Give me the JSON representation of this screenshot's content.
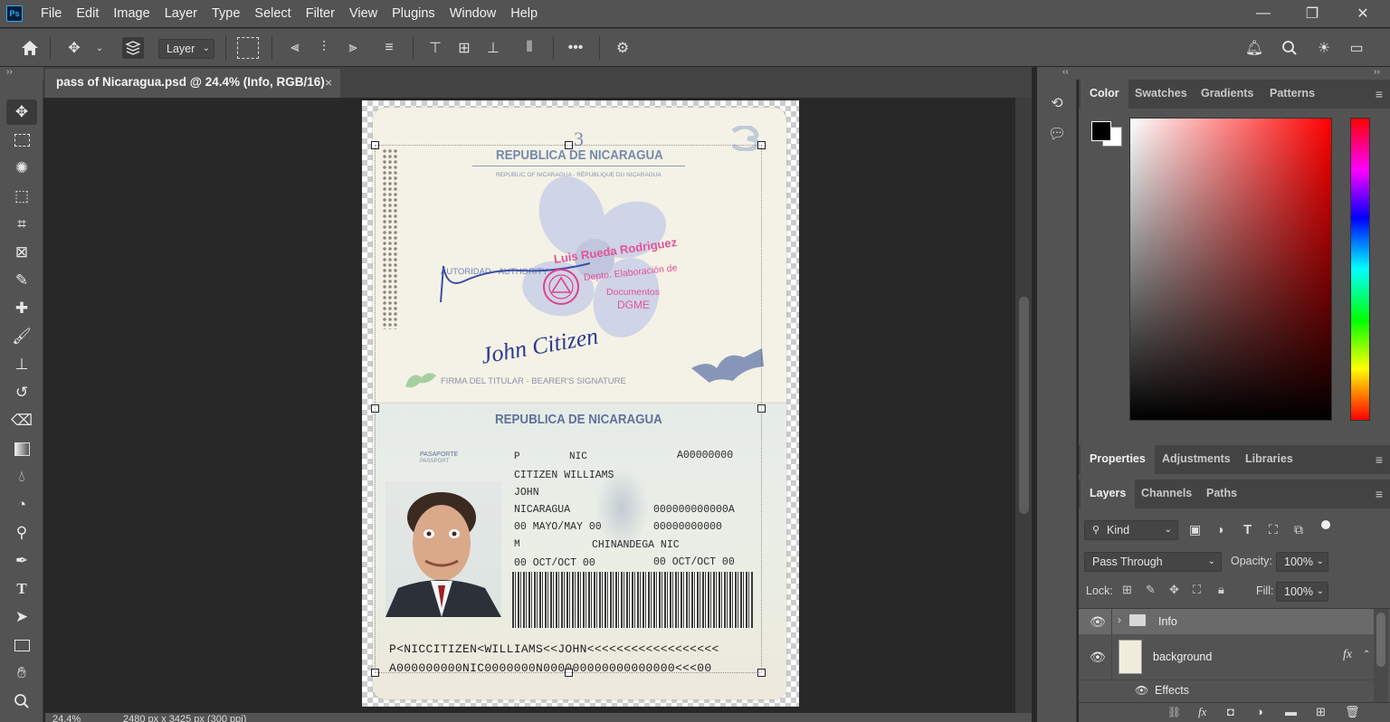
{
  "menu": [
    "File",
    "Edit",
    "Image",
    "Layer",
    "Type",
    "Select",
    "Filter",
    "View",
    "Plugins",
    "Window",
    "Help"
  ],
  "app_logo": "Ps",
  "window_controls": {
    "minimize": "—",
    "restore": "❐",
    "close": "✕"
  },
  "options_bar": {
    "auto_select_target": "Layer"
  },
  "document": {
    "tab_title": "pass of Nicaragua.psd @ 24.4% (Info, RGB/16)",
    "close": "×"
  },
  "status": {
    "zoom": "24.4%",
    "dimensions": "2480 px x 3425 px (300 ppi)"
  },
  "passport": {
    "top": {
      "page_number": "3",
      "country": "REPUBLICA DE NICARAGUA",
      "country_sub": "REPUBLIC OF NICARAGUA - RÉPUBLIQUE DU NICARAGUA",
      "authority": "AUTORIDAD - AUTHORITY",
      "official_name": "Luis Rueda Rodriguez",
      "dept_line1": "Depto. Elaboración de",
      "dept_line2": "Documentos",
      "dept_line3": "DGME",
      "signature": "John Citizen",
      "holder_signature": "FIRMA DEL TITULAR - BEARER'S SIGNATURE"
    },
    "bottom": {
      "country": "REPUBLICA DE NICARAGUA",
      "doc_label": "PASAPORTE",
      "doc_label_en": "PASSPORT",
      "type": "P",
      "country_code": "NIC",
      "passport_no": "A00000000",
      "surname": "CITIZEN WILLIAMS",
      "given_name": "JOHN",
      "nationality": "NICARAGUA",
      "dob": "00 MAYO/MAY 00",
      "sex": "M",
      "id_no": "000000000000A",
      "reg_no": "00000000000",
      "birthplace": "CHINANDEGA NIC",
      "issue": "00 OCT/OCT 00",
      "expiry": "00 OCT/OCT 00",
      "mrz1": "P<NICCITIZEN<WILLIAMS<<JOHN<<<<<<<<<<<<<<<<<<",
      "mrz2": "A000000000NIC0000000N000000000000000000<<<00"
    }
  },
  "color_panel": {
    "tabs": [
      "Color",
      "Swatches",
      "Gradients",
      "Patterns"
    ],
    "active": "Color"
  },
  "properties_panel": {
    "tabs": [
      "Properties",
      "Adjustments",
      "Libraries"
    ],
    "active": "Properties"
  },
  "layers_panel": {
    "tabs": [
      "Layers",
      "Channels",
      "Paths"
    ],
    "active": "Layers",
    "filter_kind": "Kind",
    "blend_mode": "Pass Through",
    "opacity_label": "Opacity:",
    "opacity": "100%",
    "lock_label": "Lock:",
    "fill_label": "Fill:",
    "fill": "100%",
    "layers": [
      {
        "name": "Info",
        "type": "group"
      },
      {
        "name": "background",
        "type": "layer",
        "fx": "fx"
      },
      {
        "name": "Effects",
        "type": "effects"
      }
    ]
  },
  "colors": {
    "foreground": "#000000",
    "background": "#ffffff",
    "ui_dark": "#282828",
    "ui_panel": "#535353"
  }
}
